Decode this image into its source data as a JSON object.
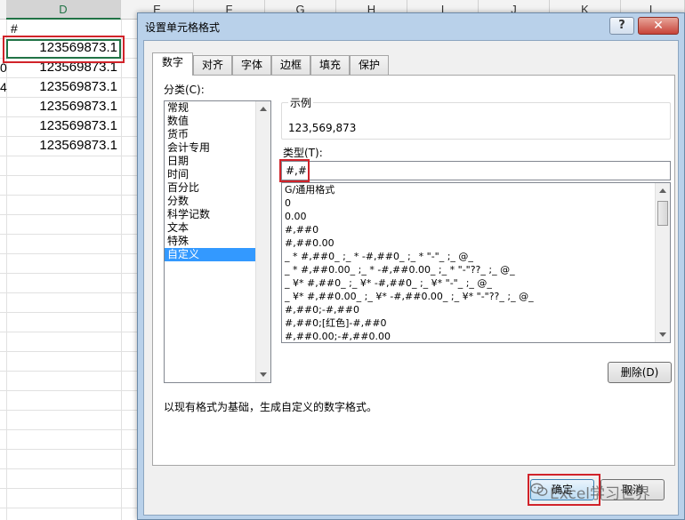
{
  "sheet": {
    "columns": [
      "D",
      "E",
      "F",
      "G",
      "H",
      "I",
      "J",
      "K",
      "L"
    ],
    "header_cell": "#",
    "col_d_values": [
      "123569873.1",
      "123569873.1",
      "123569873.1",
      "123569873.1",
      "123569873.1",
      "123569873.1"
    ],
    "col_c_partial": [
      "",
      "0",
      "4",
      "",
      "",
      ""
    ]
  },
  "dialog": {
    "title": "设置单元格格式",
    "help_label": "?",
    "close_label": "✕",
    "tabs": [
      "数字",
      "对齐",
      "字体",
      "边框",
      "填充",
      "保护"
    ],
    "active_tab": "数字",
    "category_label": "分类(C):",
    "categories": [
      "常规",
      "数值",
      "货币",
      "会计专用",
      "日期",
      "时间",
      "百分比",
      "分数",
      "科学记数",
      "文本",
      "特殊",
      "自定义"
    ],
    "selected_category": "自定义",
    "sample_label": "示例",
    "sample_value": "123,569,873",
    "type_label": "类型(T):",
    "type_value": "#,#",
    "formats": [
      "G/通用格式",
      "0",
      "0.00",
      "#,##0",
      "#,##0.00",
      "_ * #,##0_ ;_ * -#,##0_ ;_ * \"-\"_ ;_ @_",
      "_ * #,##0.00_ ;_ * -#,##0.00_ ;_ * \"-\"??_ ;_ @_",
      "_ ¥* #,##0_ ;_ ¥* -#,##0_ ;_ ¥* \"-\"_ ;_ @_",
      "_ ¥* #,##0.00_ ;_ ¥* -#,##0.00_ ;_ ¥* \"-\"??_ ;_ @_",
      "#,##0;-#,##0",
      "#,##0;[红色]-#,##0",
      "#,##0.00;-#,##0.00"
    ],
    "delete_label": "删除(D)",
    "description": "以现有格式为基础，生成自定义的数字格式。",
    "ok_label": "确定",
    "cancel_label": "取消"
  },
  "watermark": {
    "text": "Excel学习世界",
    "icon": "wechat-icon"
  },
  "colors": {
    "highlight_red": "#d1232a",
    "selection_blue": "#3399ff",
    "excel_green": "#217346"
  }
}
